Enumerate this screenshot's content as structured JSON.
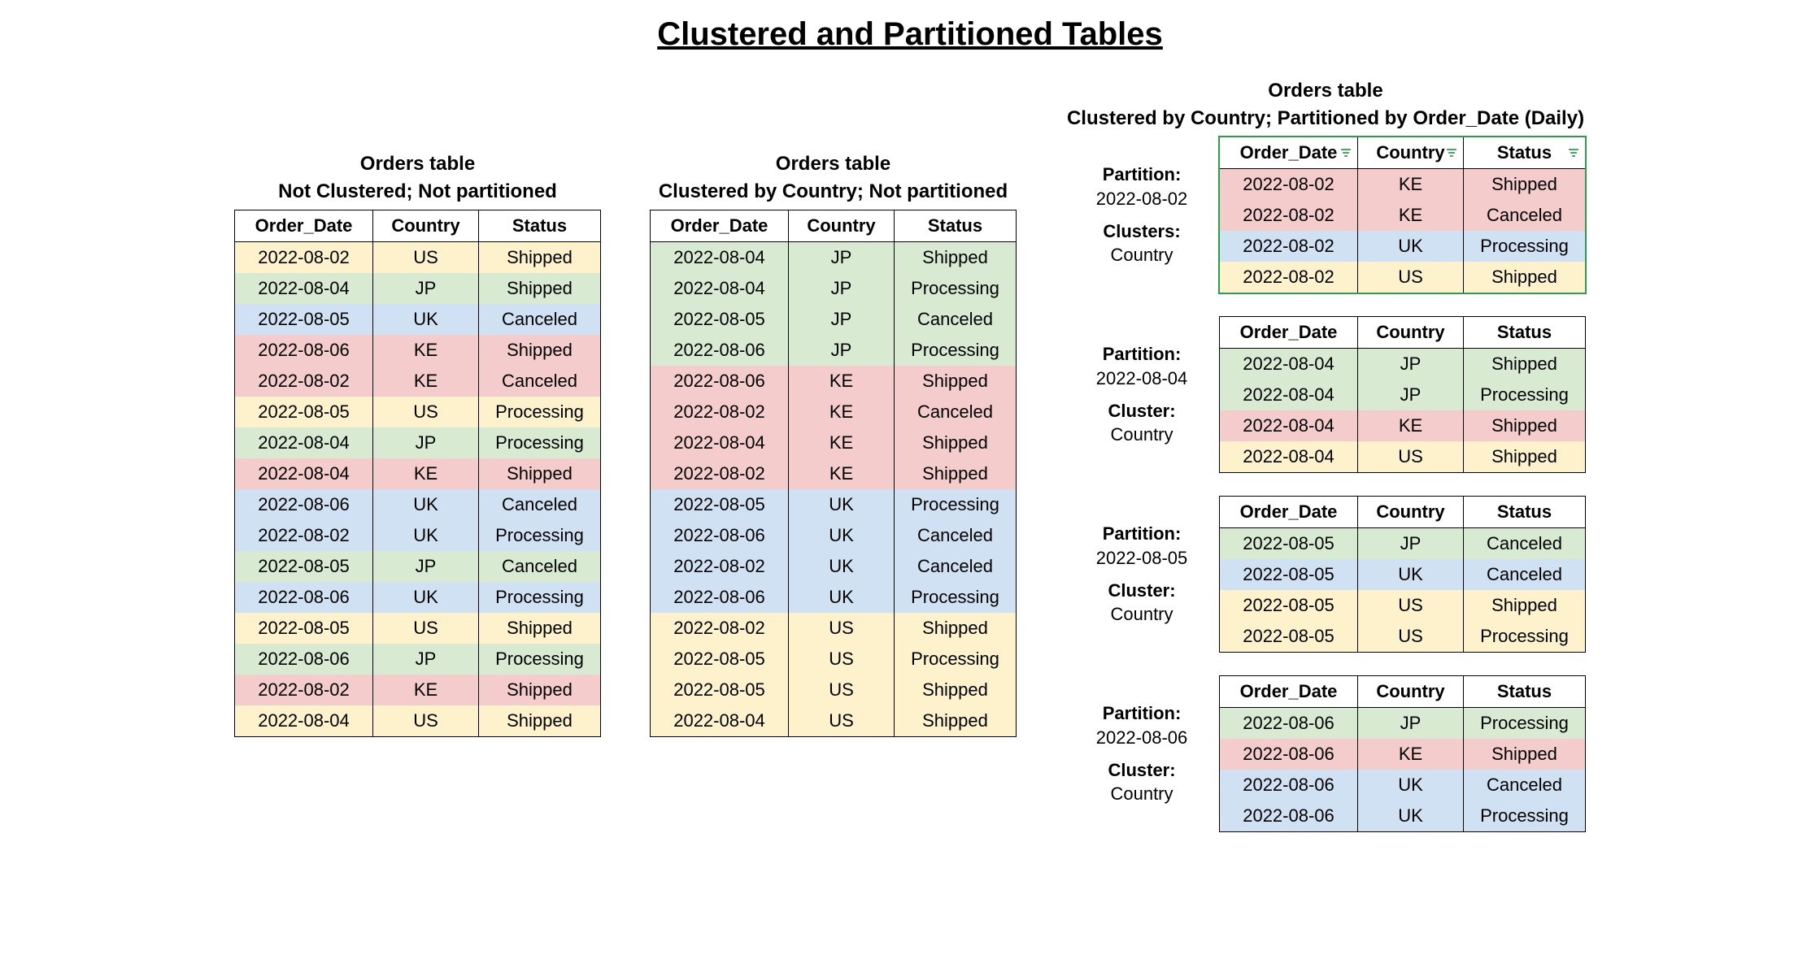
{
  "title": "Clustered and Partitioned Tables",
  "columns": [
    "Order_Date",
    "Country",
    "Status"
  ],
  "tables": {
    "left": {
      "name": "Orders table",
      "sub": "Not Clustered; Not partitioned",
      "rows": [
        {
          "date": "2022-08-02",
          "country": "US",
          "status": "Shipped"
        },
        {
          "date": "2022-08-04",
          "country": "JP",
          "status": "Shipped"
        },
        {
          "date": "2022-08-05",
          "country": "UK",
          "status": "Canceled"
        },
        {
          "date": "2022-08-06",
          "country": "KE",
          "status": "Shipped"
        },
        {
          "date": "2022-08-02",
          "country": "KE",
          "status": "Canceled"
        },
        {
          "date": "2022-08-05",
          "country": "US",
          "status": "Processing"
        },
        {
          "date": "2022-08-04",
          "country": "JP",
          "status": "Processing"
        },
        {
          "date": "2022-08-04",
          "country": "KE",
          "status": "Shipped"
        },
        {
          "date": "2022-08-06",
          "country": "UK",
          "status": "Canceled"
        },
        {
          "date": "2022-08-02",
          "country": "UK",
          "status": "Processing"
        },
        {
          "date": "2022-08-05",
          "country": "JP",
          "status": "Canceled"
        },
        {
          "date": "2022-08-06",
          "country": "UK",
          "status": "Processing"
        },
        {
          "date": "2022-08-05",
          "country": "US",
          "status": "Shipped"
        },
        {
          "date": "2022-08-06",
          "country": "JP",
          "status": "Processing"
        },
        {
          "date": "2022-08-02",
          "country": "KE",
          "status": "Shipped"
        },
        {
          "date": "2022-08-04",
          "country": "US",
          "status": "Shipped"
        }
      ]
    },
    "middle": {
      "name": "Orders table",
      "sub": "Clustered by Country; Not partitioned",
      "rows": [
        {
          "date": "2022-08-04",
          "country": "JP",
          "status": "Shipped"
        },
        {
          "date": "2022-08-04",
          "country": "JP",
          "status": "Processing"
        },
        {
          "date": "2022-08-05",
          "country": "JP",
          "status": "Canceled"
        },
        {
          "date": "2022-08-06",
          "country": "JP",
          "status": "Processing"
        },
        {
          "date": "2022-08-06",
          "country": "KE",
          "status": "Shipped"
        },
        {
          "date": "2022-08-02",
          "country": "KE",
          "status": "Canceled"
        },
        {
          "date": "2022-08-04",
          "country": "KE",
          "status": "Shipped"
        },
        {
          "date": "2022-08-02",
          "country": "KE",
          "status": "Shipped"
        },
        {
          "date": "2022-08-05",
          "country": "UK",
          "status": "Processing"
        },
        {
          "date": "2022-08-06",
          "country": "UK",
          "status": "Canceled"
        },
        {
          "date": "2022-08-02",
          "country": "UK",
          "status": "Canceled"
        },
        {
          "date": "2022-08-06",
          "country": "UK",
          "status": "Processing"
        },
        {
          "date": "2022-08-02",
          "country": "US",
          "status": "Shipped"
        },
        {
          "date": "2022-08-05",
          "country": "US",
          "status": "Processing"
        },
        {
          "date": "2022-08-05",
          "country": "US",
          "status": "Shipped"
        },
        {
          "date": "2022-08-04",
          "country": "US",
          "status": "Shipped"
        }
      ]
    },
    "right": {
      "name": "Orders table",
      "sub": "Clustered by Country; Partitioned by Order_Date (Daily)",
      "partitions": [
        {
          "partition_label": "Partition:",
          "partition_value": "2022-08-02",
          "cluster_label": "Clusters:",
          "cluster_value": "Country",
          "highlight": true,
          "filter_icons": true,
          "rows": [
            {
              "date": "2022-08-02",
              "country": "KE",
              "status": "Shipped"
            },
            {
              "date": "2022-08-02",
              "country": "KE",
              "status": "Canceled"
            },
            {
              "date": "2022-08-02",
              "country": "UK",
              "status": "Processing"
            },
            {
              "date": "2022-08-02",
              "country": "US",
              "status": "Shipped"
            }
          ]
        },
        {
          "partition_label": "Partition:",
          "partition_value": "2022-08-04",
          "cluster_label": "Cluster:",
          "cluster_value": "Country",
          "rows": [
            {
              "date": "2022-08-04",
              "country": "JP",
              "status": "Shipped"
            },
            {
              "date": "2022-08-04",
              "country": "JP",
              "status": "Processing"
            },
            {
              "date": "2022-08-04",
              "country": "KE",
              "status": "Shipped"
            },
            {
              "date": "2022-08-04",
              "country": "US",
              "status": "Shipped"
            }
          ]
        },
        {
          "partition_label": "Partition:",
          "partition_value": "2022-08-05",
          "cluster_label": "Cluster:",
          "cluster_value": "Country",
          "rows": [
            {
              "date": "2022-08-05",
              "country": "JP",
              "status": "Canceled"
            },
            {
              "date": "2022-08-05",
              "country": "UK",
              "status": "Canceled"
            },
            {
              "date": "2022-08-05",
              "country": "US",
              "status": "Shipped"
            },
            {
              "date": "2022-08-05",
              "country": "US",
              "status": "Processing"
            }
          ]
        },
        {
          "partition_label": "Partition:",
          "partition_value": "2022-08-06",
          "cluster_label": "Cluster:",
          "cluster_value": "Country",
          "rows": [
            {
              "date": "2022-08-06",
              "country": "JP",
              "status": "Processing"
            },
            {
              "date": "2022-08-06",
              "country": "KE",
              "status": "Shipped"
            },
            {
              "date": "2022-08-06",
              "country": "UK",
              "status": "Canceled"
            },
            {
              "date": "2022-08-06",
              "country": "UK",
              "status": "Processing"
            }
          ]
        }
      ]
    }
  }
}
